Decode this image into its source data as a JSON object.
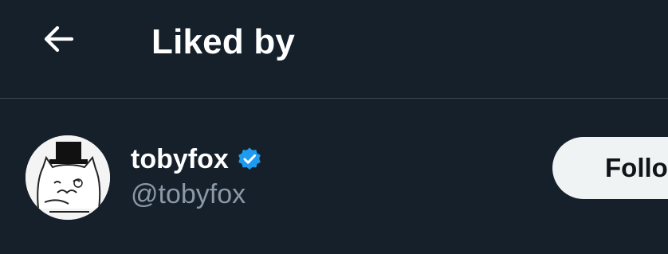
{
  "header": {
    "title": "Liked by",
    "back_icon": "arrow-left-icon"
  },
  "users": [
    {
      "display_name": "tobyfox",
      "handle": "@tobyfox",
      "verified": true,
      "verified_icon": "verified-badge-icon",
      "follow_label": "Follo"
    }
  ],
  "colors": {
    "background": "#15202b",
    "divider": "#38444d",
    "text_primary": "#ffffff",
    "text_secondary": "#8b98a5",
    "verified_blue": "#1d9bf0",
    "button_bg": "#eff3f4",
    "button_text": "#0f1419"
  }
}
